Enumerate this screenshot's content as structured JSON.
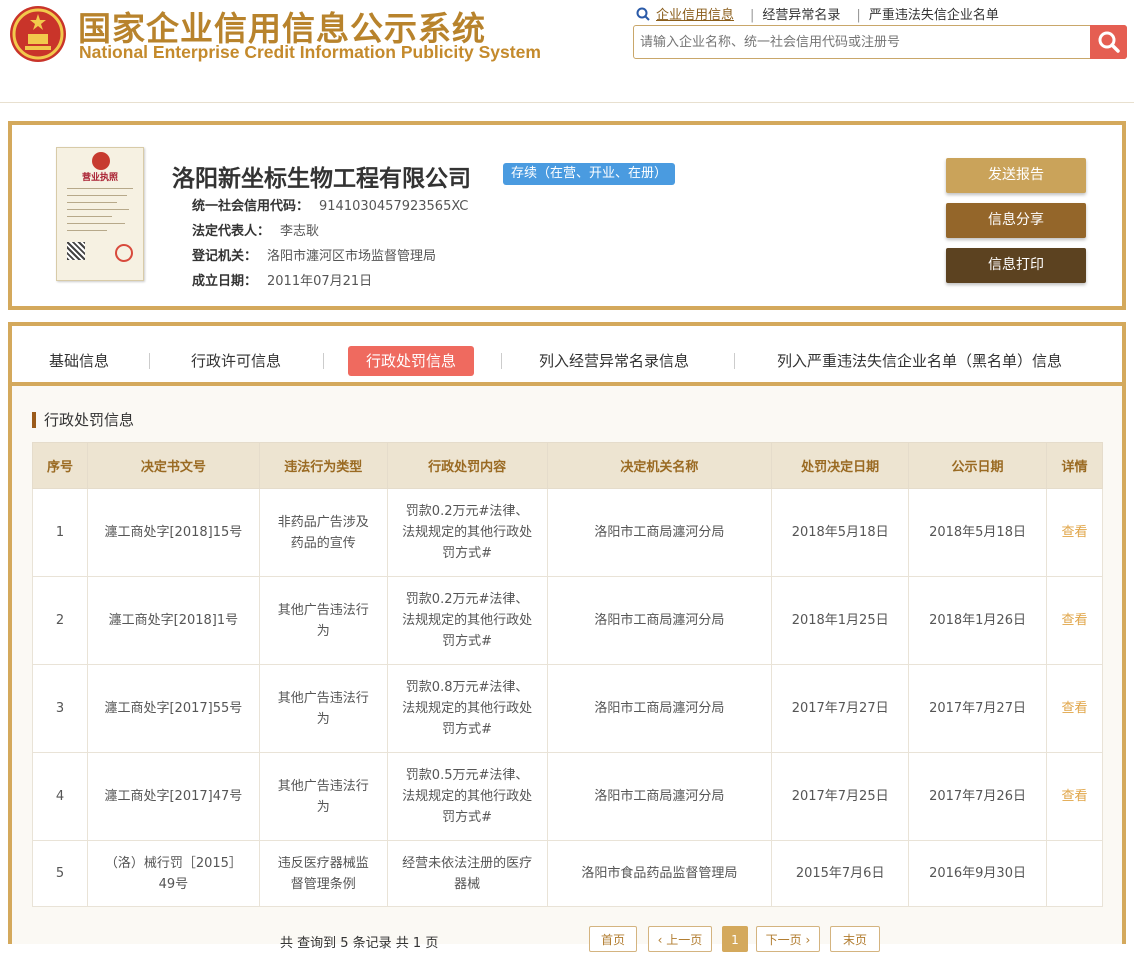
{
  "header": {
    "title_cn": "国家企业信用信息公示系统",
    "title_en": "National Enterprise Credit Information Publicity System",
    "links": [
      "企业信用信息",
      "经营异常名录",
      "严重违法失信企业名单"
    ],
    "search_placeholder": "请输入企业名称、统一社会信用代码或注册号"
  },
  "company": {
    "license_title": "营业执照",
    "name": "洛阳新坐标生物工程有限公司",
    "status": "存续（在营、开业、在册）",
    "fields": [
      {
        "label": "统一社会信用代码：",
        "value": "9141030457923565XC"
      },
      {
        "label": "法定代表人：",
        "value": "李志耿"
      },
      {
        "label": "登记机关：",
        "value": "洛阳市瀍河区市场监督管理局"
      },
      {
        "label": "成立日期：",
        "value": "2011年07月21日"
      }
    ],
    "buttons": [
      "发送报告",
      "信息分享",
      "信息打印"
    ]
  },
  "tabs": [
    "基础信息",
    "行政许可信息",
    "行政处罚信息",
    "列入经营异常名录信息",
    "列入严重违法失信企业名单（黑名单）信息"
  ],
  "active_tab": "行政处罚信息",
  "section_title": "行政处罚信息",
  "table": {
    "headers": [
      "序号",
      "决定书文号",
      "违法行为类型",
      "行政处罚内容",
      "决定机关名称",
      "处罚决定日期",
      "公示日期",
      "详情"
    ],
    "rows": [
      [
        "1",
        "瀍工商处字[2018]15号",
        "非药品广告涉及药品的宣传",
        "罚款0.2万元#法律、法规规定的其他行政处罚方式#",
        "洛阳市工商局瀍河分局",
        "2018年5月18日",
        "2018年5月18日",
        "查看"
      ],
      [
        "2",
        "瀍工商处字[2018]1号",
        "其他广告违法行为",
        "罚款0.2万元#法律、法规规定的其他行政处罚方式#",
        "洛阳市工商局瀍河分局",
        "2018年1月25日",
        "2018年1月26日",
        "查看"
      ],
      [
        "3",
        "瀍工商处字[2017]55号",
        "其他广告违法行为",
        "罚款0.8万元#法律、法规规定的其他行政处罚方式#",
        "洛阳市工商局瀍河分局",
        "2017年7月27日",
        "2017年7月27日",
        "查看"
      ],
      [
        "4",
        "瀍工商处字[2017]47号",
        "其他广告违法行为",
        "罚款0.5万元#法律、法规规定的其他行政处罚方式#",
        "洛阳市工商局瀍河分局",
        "2017年7月25日",
        "2017年7月26日",
        "查看"
      ],
      [
        "5",
        "（洛）械行罚［2015］49号",
        "违反医疗器械监督管理条例",
        "经营未依法注册的医疗器械",
        "洛阳市食品药品监督管理局",
        "2015年7月6日",
        "2016年9月30日",
        ""
      ]
    ]
  },
  "pager": {
    "summary": "共 查询到 5 条记录 共 1 页",
    "first": "首页",
    "prev": "上一页",
    "current": "1",
    "next": "下一页",
    "last": "末页"
  },
  "colors": {
    "brand_gold": "#d4a95c",
    "title_gold": "#b8832c",
    "active_tab": "#ef6a5f",
    "status_blue": "#4a9be0",
    "btn_send": "#caa35a",
    "btn_share": "#94662a",
    "btn_print": "#5c4220"
  }
}
